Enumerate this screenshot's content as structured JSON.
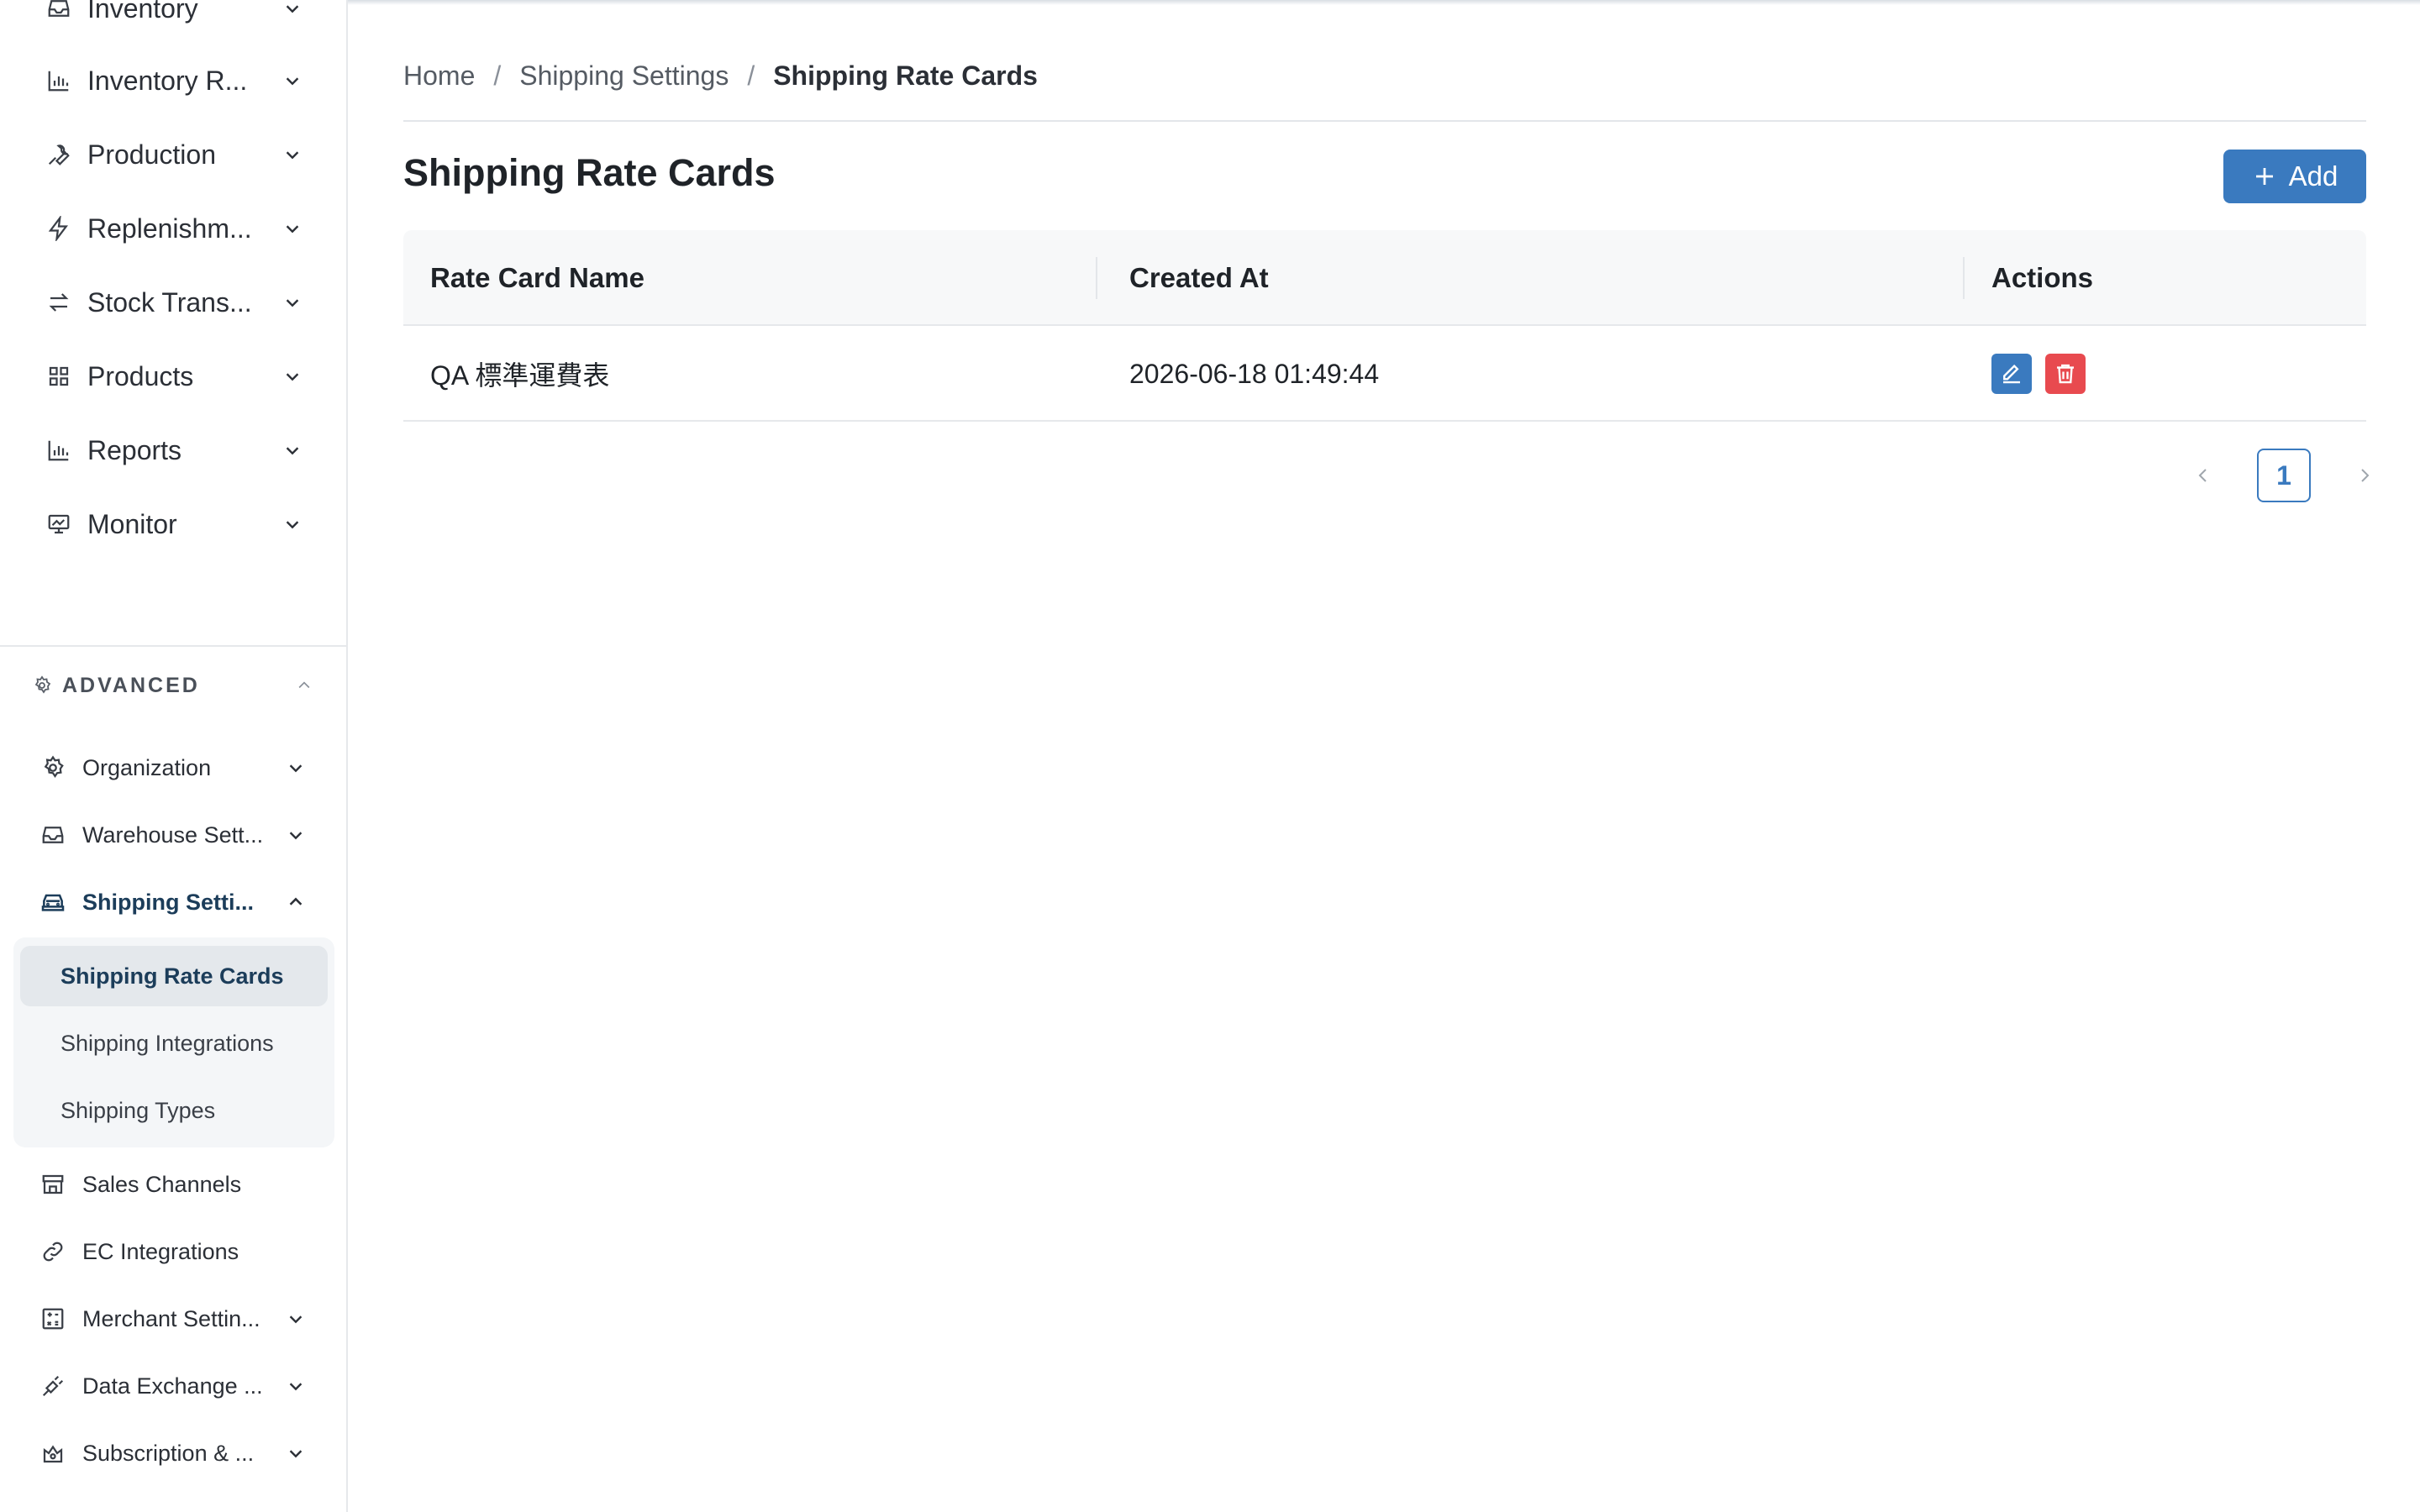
{
  "sidebar": {
    "main_items": [
      {
        "label": "Inventory",
        "icon": "inbox-icon"
      },
      {
        "label": "Inventory R...",
        "icon": "bar-chart-icon"
      },
      {
        "label": "Production",
        "icon": "wrench-icon"
      },
      {
        "label": "Replenishm...",
        "icon": "bolt-icon"
      },
      {
        "label": "Stock Trans...",
        "icon": "transfer-arrows-icon"
      },
      {
        "label": "Products",
        "icon": "grid-icon"
      },
      {
        "label": "Reports",
        "icon": "bar-chart-icon"
      },
      {
        "label": "Monitor",
        "icon": "monitor-chart-icon"
      }
    ],
    "advanced_label": "ADVANCED",
    "advanced_items": [
      {
        "label": "Organization",
        "icon": "gear-icon"
      },
      {
        "label": "Warehouse Sett...",
        "icon": "inbox-icon"
      },
      {
        "label": "Shipping Setti...",
        "icon": "car-icon"
      },
      {
        "label": "Sales Channels",
        "icon": "storefront-icon"
      },
      {
        "label": "EC Integrations",
        "icon": "link-icon"
      },
      {
        "label": "Merchant Settin...",
        "icon": "calculator-icon"
      },
      {
        "label": "Data Exchange ...",
        "icon": "plug-icon"
      },
      {
        "label": "Subscription & ...",
        "icon": "badge-icon"
      }
    ],
    "shipping_sub_items": [
      {
        "label": "Shipping Rate Cards",
        "active": true
      },
      {
        "label": "Shipping Integrations",
        "active": false
      },
      {
        "label": "Shipping Types",
        "active": false
      }
    ]
  },
  "breadcrumb": {
    "items": [
      "Home",
      "Shipping Settings",
      "Shipping Rate Cards"
    ],
    "separator": "/"
  },
  "page": {
    "title": "Shipping Rate Cards",
    "add_label": "Add"
  },
  "table": {
    "columns": [
      "Rate Card Name",
      "Created At",
      "Actions"
    ],
    "rows": [
      {
        "name": "QA 標準運費表",
        "created_at": "2026-06-18 01:49:44"
      }
    ]
  },
  "pagination": {
    "current_page": "1"
  },
  "colors": {
    "primary": "#3a7abf",
    "danger": "#e84a4f",
    "active_text": "#1c3d5a"
  }
}
